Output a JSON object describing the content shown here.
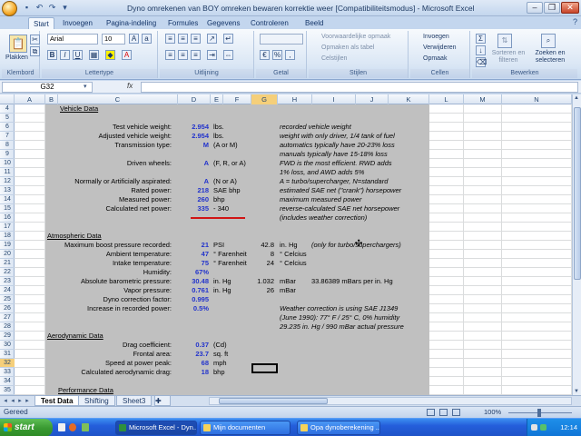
{
  "window": {
    "title": "Dyno omrekenen van BOY omreken bewaren korrektie weer  [Compatibiliteitsmodus]  -  Microsoft Excel"
  },
  "ribbon": {
    "tabs": [
      "Start",
      "Invoegen",
      "Pagina-indeling",
      "Formules",
      "Gegevens",
      "Controleren",
      "Beeld"
    ],
    "active_tab": "Start",
    "font_name": "Arial",
    "font_size": "10",
    "paste_label": "Plakken",
    "groups": [
      "Klembord",
      "Lettertype",
      "Uitlijning",
      "Getal",
      "Stijlen",
      "Cellen",
      "Bewerken"
    ],
    "styles_buttons": [
      "Voorwaardelijke opmaak",
      "Opmaken als tabel",
      "Celstijlen"
    ],
    "cells_buttons": [
      "Invoegen",
      "Verwijderen",
      "Opmaak"
    ],
    "edit_buttons": [
      "Sorteren en filteren",
      "Zoeken en selecteren"
    ]
  },
  "formula_bar": {
    "name_box": "G32",
    "fx": "fx",
    "content": ""
  },
  "columns": [
    "A",
    "B",
    "C",
    "D",
    "E",
    "F",
    "G",
    "H",
    "I",
    "J",
    "K",
    "L",
    "M",
    "N"
  ],
  "selected_column": "G",
  "selected_row": "32",
  "rows": [
    "4",
    "5",
    "6",
    "7",
    "8",
    "9",
    "10",
    "11",
    "12",
    "13",
    "14",
    "15",
    "16",
    "17",
    "18",
    "19",
    "20",
    "21",
    "22",
    "23",
    "24",
    "25",
    "26",
    "27",
    "28",
    "29",
    "30",
    "31",
    "32",
    "33",
    "34",
    "35"
  ],
  "sheet": {
    "vehicle": {
      "heading": "Vehicle Data",
      "rows": [
        {
          "label": "Test vehicle weight:",
          "value": "2.954",
          "unit": "lbs.",
          "note": "recorded vehicle weight"
        },
        {
          "label": "Adjusted vehicle weight:",
          "value": "2.954",
          "unit": "lbs.",
          "note": "weight with only driver, 1/4 tank of fuel"
        },
        {
          "label": "Transmission type:",
          "value": "M",
          "unit": "(A or M)",
          "note": "automatics typically have 20-23% loss"
        },
        {
          "label": "",
          "value": "",
          "unit": "",
          "note": "manuals typically have 15-18% loss"
        },
        {
          "label": "Driven wheels:",
          "value": "A",
          "unit": "(F, R, or A)",
          "note": "FWD is the most efficient.  RWD adds"
        },
        {
          "label": "",
          "value": "",
          "unit": "",
          "note": "1% loss, and AWD adds 5%"
        },
        {
          "label": "Normally or Artificially aspirated:",
          "value": "A",
          "unit": "(N or A)",
          "note": "A = turbo/supercharger, N=standard"
        },
        {
          "label": "Rated power:",
          "value": "218",
          "unit": "SAE bhp",
          "note": "estimated SAE net (\"crank\") horsepower"
        },
        {
          "label": "Measured power:",
          "value": "260",
          "unit": "bhp",
          "note": "maximum measured power"
        },
        {
          "label": "Calculated net power:",
          "value": "335",
          "unit": "-   340",
          "note": "reverse-calculated SAE net horsepower"
        },
        {
          "label": "",
          "value": "",
          "unit": "",
          "note": "(includes weather correction)"
        }
      ]
    },
    "atmospheric": {
      "heading": "Atmospheric Data",
      "rows": [
        {
          "label": "Maximum boost pressure recorded:",
          "value": "21",
          "unit": "PSI",
          "g": "42.8",
          "h": "in. Hg",
          "extra": "(only for turbo/superchargers)"
        },
        {
          "label": "Ambient temperature:",
          "value": "47",
          "unit": "° Farenheit",
          "g": "8",
          "h": "° Celcius",
          "extra": ""
        },
        {
          "label": "Intake temperature:",
          "value": "75",
          "unit": "° Farenheit",
          "g": "24",
          "h": "° Celcius",
          "extra": ""
        },
        {
          "label": "Humidity:",
          "value": "67%",
          "unit": "",
          "g": "",
          "h": "",
          "extra": ""
        },
        {
          "label": "Absolute barometric pressure:",
          "value": "30.48",
          "unit": "in. Hg",
          "g": "1.032",
          "h": "mBar",
          "extra": "33.86389 mBars per in. Hg"
        },
        {
          "label": "Vapor pressure:",
          "value": "0.761",
          "unit": "in. Hg",
          "g": "26",
          "h": "mBar",
          "extra": ""
        },
        {
          "label": "Dyno correction factor:",
          "value": "0.995",
          "unit": "",
          "g": "",
          "h": "",
          "extra": ""
        },
        {
          "label": "Increase in recorded power:",
          "value": "0.5%",
          "unit": "",
          "g": "",
          "h": "",
          "extra": ""
        }
      ],
      "notes": [
        "Weather correction is using SAE J1349",
        "(June 1990):  77° F / 25° C, 0% humidity",
        "29.235 in. Hg / 990 mBar actual pressure"
      ]
    },
    "aero": {
      "heading": "Aerodynamic Data",
      "rows": [
        {
          "label": "Drag coefficient:",
          "value": "0.37",
          "unit": "(Cd)"
        },
        {
          "label": "Frontal area:",
          "value": "23.7",
          "unit": "sq. ft"
        },
        {
          "label": "Speed at power peak:",
          "value": "68",
          "unit": "mph"
        },
        {
          "label": "Calculated aerodynamic drag:",
          "value": "18",
          "unit": "bhp"
        }
      ]
    },
    "next_heading": "Performance Data"
  },
  "sheet_tabs": [
    "Test Data",
    "Shifting",
    "Sheet3"
  ],
  "status": {
    "text": "Gereed",
    "zoom": "100%"
  },
  "taskbar": {
    "start_label": "start",
    "buttons": [
      "Microsoft Excel - Dyn...",
      "Mijn documenten",
      "Opa dynoberekening ..."
    ],
    "clock": "12:14"
  },
  "colors": {
    "value_blue": "#2233cc",
    "sheet_gray": "#c0c0c0",
    "underline_red": "#d01515",
    "selection": "#f5cf7a"
  }
}
